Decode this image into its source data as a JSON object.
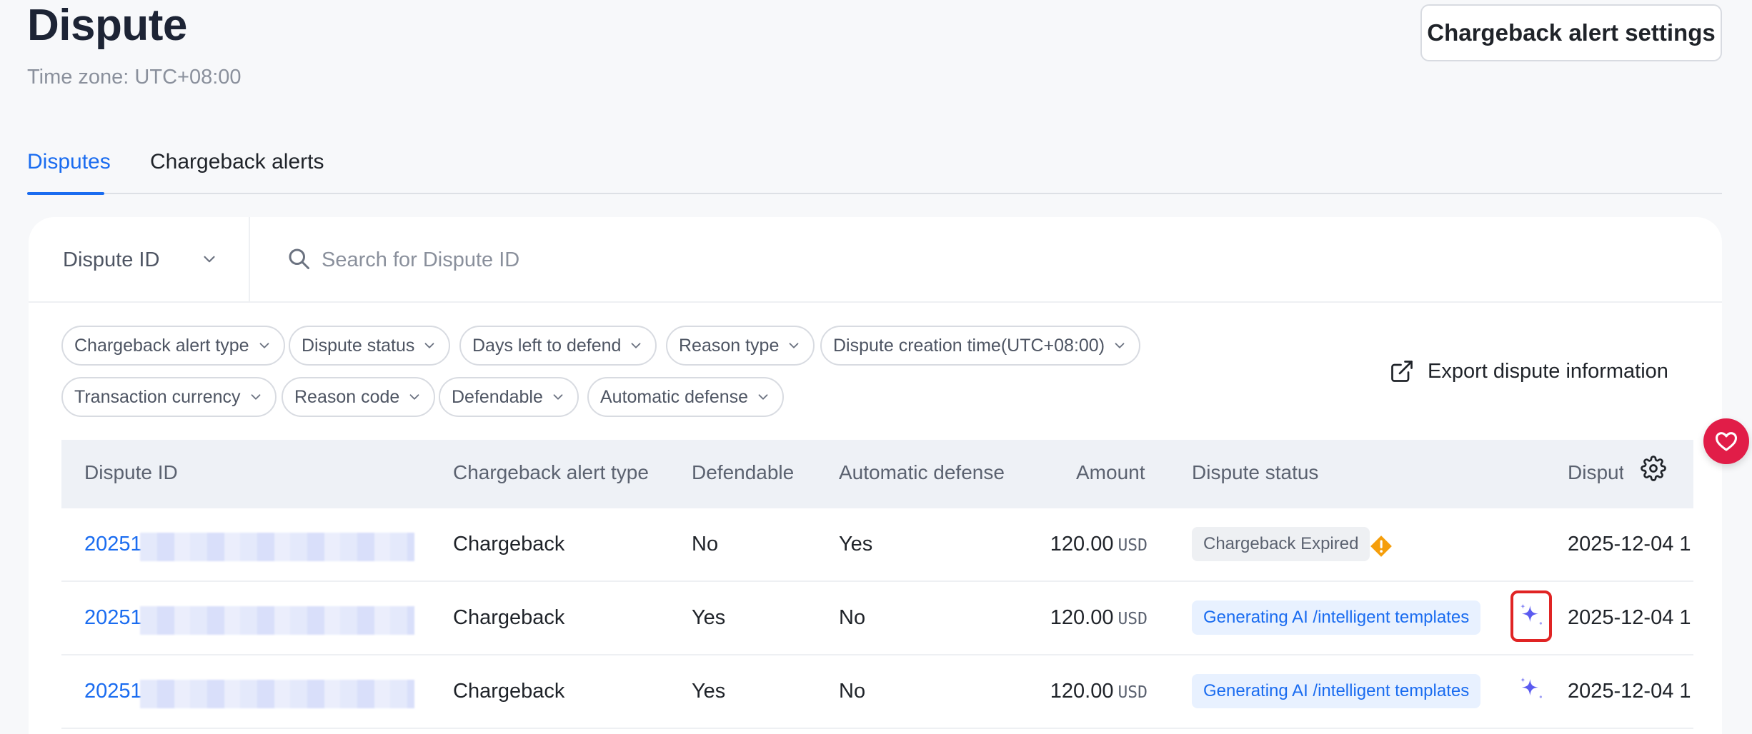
{
  "header": {
    "title": "Dispute",
    "timezone": "Time zone: UTC+08:00",
    "alert_settings_label": "Chargeback alert settings"
  },
  "tabs": [
    {
      "label": "Disputes",
      "active": true
    },
    {
      "label": "Chargeback alerts",
      "active": false
    }
  ],
  "search": {
    "field_select": "Dispute ID",
    "placeholder": "Search for Dispute ID",
    "value": ""
  },
  "filters": [
    "Chargeback alert type",
    "Dispute status",
    "Days left to defend",
    "Reason type",
    "Dispute creation time(UTC+08:00)",
    "Transaction currency",
    "Reason code",
    "Defendable",
    "Automatic defense"
  ],
  "export_label": "Export dispute information",
  "table": {
    "columns": [
      "Dispute ID",
      "Chargeback alert type",
      "Defendable",
      "Automatic defense",
      "Amount",
      "Dispute status",
      "Disput"
    ],
    "rows": [
      {
        "id": "20251",
        "type": "Chargeback",
        "defendable": "No",
        "auto": "Yes",
        "amount": "120.00",
        "currency": "USD",
        "status": "Chargeback Expired",
        "status_kind": "expired",
        "date": "2025-12-04 1"
      },
      {
        "id": "20251",
        "type": "Chargeback",
        "defendable": "Yes",
        "auto": "No",
        "amount": "120.00",
        "currency": "USD",
        "status": "Generating AI /intelligent templates",
        "status_kind": "ai",
        "date": "2025-12-04 1"
      },
      {
        "id": "20251",
        "type": "Chargeback",
        "defendable": "Yes",
        "auto": "No",
        "amount": "120.00",
        "currency": "USD",
        "status": "Generating AI /intelligent templates",
        "status_kind": "ai",
        "date": "2025-12-04 1"
      }
    ]
  },
  "colors": {
    "accent": "#1a6cf0",
    "warning": "#f59e0b",
    "highlight": "#e02424",
    "sparkle": "#5b5bf0"
  }
}
